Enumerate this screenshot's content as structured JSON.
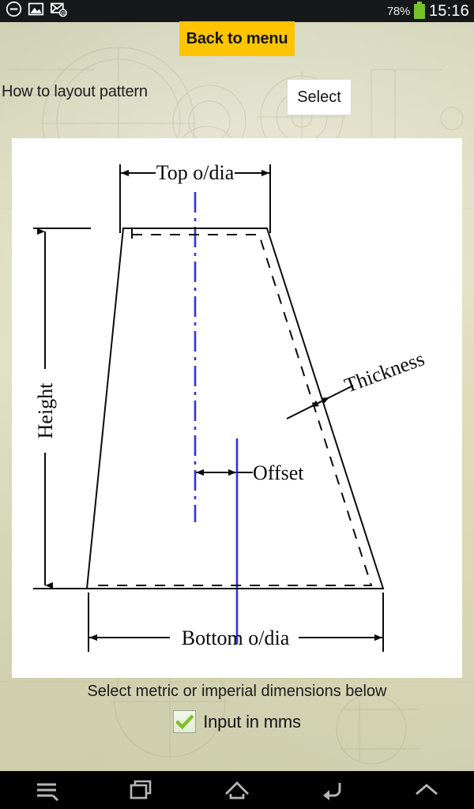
{
  "statusbar": {
    "icons": [
      "do-not-disturb-icon",
      "gallery-image-icon",
      "email-at-icon"
    ],
    "battery_percent": "78%",
    "clock": "15:16"
  },
  "header": {
    "back_to_menu_label": "Back to menu",
    "page_title": "How to layout pattern",
    "select_label": "Select"
  },
  "diagram": {
    "labels": {
      "top_dia": "Top o/dia",
      "bottom_dia": "Bottom o/dia",
      "height": "Height",
      "thickness": "Thickness",
      "offset": "Offset"
    },
    "colors": {
      "line": "#0b0b0b",
      "centerline": "#3333dd",
      "panel": "#ffffff"
    }
  },
  "footer": {
    "units_prompt": "Select metric or imperial dimensions below",
    "checkbox_label": "Input in mms",
    "checkbox_checked": true
  },
  "navbar": {
    "items": [
      {
        "name": "menu",
        "icon": "menu-icon"
      },
      {
        "name": "recents",
        "icon": "recent-apps-icon"
      },
      {
        "name": "home",
        "icon": "home-icon"
      },
      {
        "name": "back",
        "icon": "back-arrow-icon"
      },
      {
        "name": "expand",
        "icon": "chevron-up-icon"
      }
    ]
  },
  "theme": {
    "accent": "#fec400",
    "battery_green": "#76c32a",
    "check_green": "#7fc02b",
    "statusbar_bg": "#16191a",
    "paper": "#dcdcc2"
  }
}
